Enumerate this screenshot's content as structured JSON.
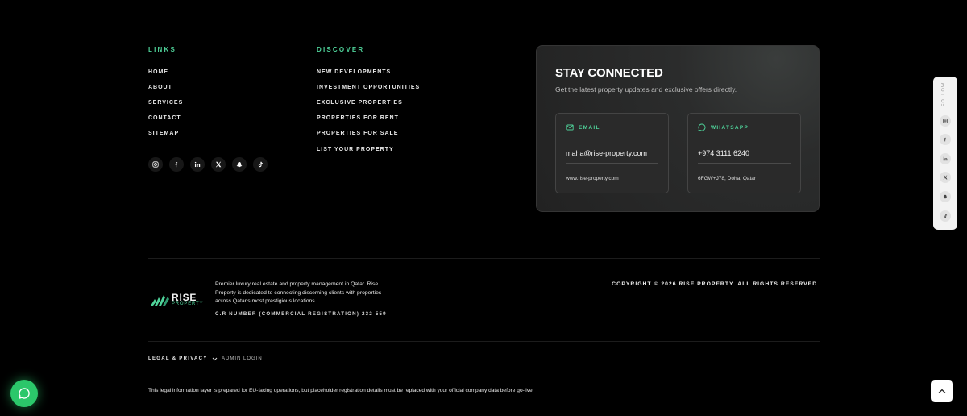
{
  "links": {
    "title": "LINKS",
    "items": [
      "HOME",
      "ABOUT",
      "SERVICES",
      "CONTACT",
      "SITEMAP"
    ]
  },
  "discover": {
    "title": "DISCOVER",
    "items": [
      "NEW DEVELOPMENTS",
      "INVESTMENT OPPORTUNITIES",
      "EXCLUSIVE PROPERTIES",
      "PROPERTIES FOR RENT",
      "PROPERTIES FOR SALE",
      "LIST YOUR PROPERTY"
    ]
  },
  "social": [
    "instagram-icon",
    "facebook-icon",
    "linkedin-icon",
    "x-icon",
    "snapchat-icon",
    "tiktok-icon"
  ],
  "stay_connected": {
    "title": "STAY CONNECTED",
    "subtitle": "Get the latest property updates and exclusive offers directly.",
    "email": {
      "label": "EMAIL",
      "value": "maha@rise-property.com",
      "extra": "www.rise-property.com"
    },
    "whatsapp": {
      "label": "WHATSAPP",
      "value": "+974 3111 6240",
      "extra": "6FGW+J78, Doha, Qatar"
    }
  },
  "follow": {
    "label": "FOLLOW"
  },
  "brand": {
    "name": "RISE",
    "sub": "PROPERTY",
    "description": "Premier luxury real estate and property management in Qatar. Rise Property is dedicated to connecting discerning clients with properties across Qatar's most prestigious locations.",
    "cr": "C.R NUMBER (COMMERCIAL REGISTRATION) 232 559",
    "copyright": "COPYRIGHT © 2026 RISE PROPERTY. ALL RIGHTS RESERVED."
  },
  "footer": {
    "legal_label": "LEGAL & PRIVACY",
    "admin_label": "ADMIN LOGIN",
    "notice": "This legal information layer is prepared for EU-facing operations, but placeholder registration details must be replaced with your official company data before go-live."
  },
  "colors": {
    "accent": "#4fd39a",
    "whatsapp": "#2bc76a"
  }
}
